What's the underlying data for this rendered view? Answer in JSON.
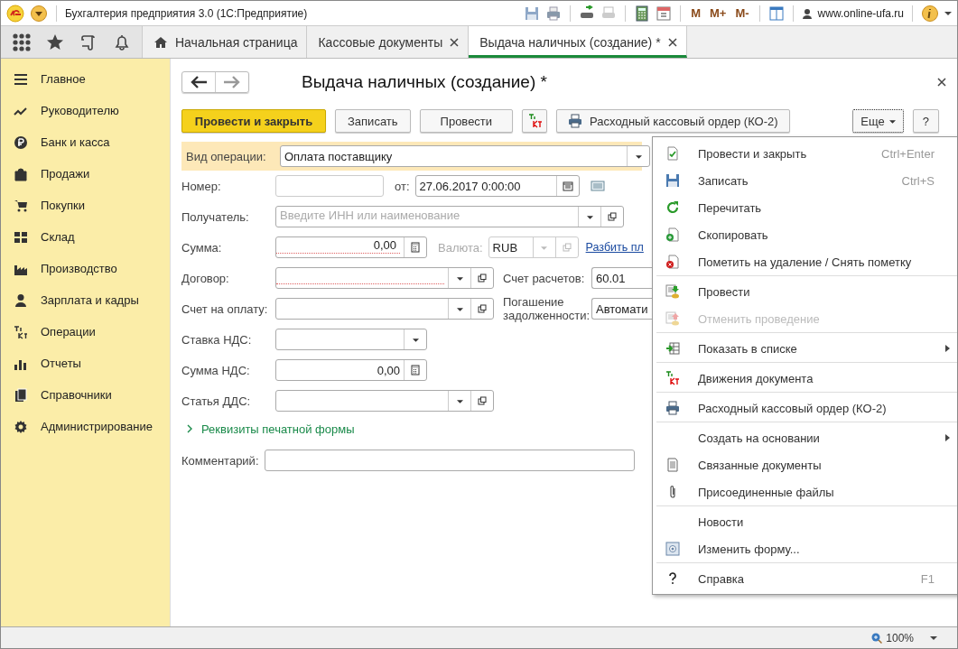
{
  "window": {
    "title": "Бухгалтерия предприятия 3.0  (1С:Предприятие)",
    "user": "www.online-ufa.ru"
  },
  "toolbar_memory": [
    "M",
    "M+",
    "M-"
  ],
  "tabs": [
    {
      "label": "Начальная страница",
      "kind": "home",
      "selected": false
    },
    {
      "label": "Кассовые документы",
      "kind": "doc",
      "selected": false
    },
    {
      "label": "Выдача наличных (создание) *",
      "kind": "doc",
      "selected": true
    }
  ],
  "sidebar": {
    "items": [
      {
        "label": "Главное",
        "kind": "lines"
      },
      {
        "label": "Руководителю",
        "kind": "trend"
      },
      {
        "label": "Банк и касса",
        "kind": "coin"
      },
      {
        "label": "Продажи",
        "kind": "bag"
      },
      {
        "label": "Покупки",
        "kind": "cart"
      },
      {
        "label": "Склад",
        "kind": "grid"
      },
      {
        "label": "Производство",
        "kind": "factory"
      },
      {
        "label": "Зарплата и кадры",
        "kind": "person"
      },
      {
        "label": "Операции",
        "kind": "dtkt"
      },
      {
        "label": "Отчеты",
        "kind": "bars"
      },
      {
        "label": "Справочники",
        "kind": "books"
      },
      {
        "label": "Администрирование",
        "kind": "gear"
      }
    ]
  },
  "form": {
    "title": "Выдача наличных (создание) *",
    "buttons": [
      {
        "label": "Провести и закрыть",
        "kind": "primary"
      },
      {
        "label": "Записать",
        "kind": "normal"
      },
      {
        "label": "Провести",
        "kind": "normal"
      },
      {
        "kind": "dtkt"
      },
      {
        "label": "Расходный кассовый ордер (КО-2)",
        "kind": "print"
      }
    ],
    "more_button": "Еще",
    "help_button": "?",
    "operation_type": {
      "label": "Вид операции:",
      "value": "Оплата поставщику"
    },
    "number": {
      "label": "Номер:"
    },
    "date": {
      "label": "от:",
      "value": "27.06.2017  0:00:00"
    },
    "recipient": {
      "label": "Получатель:",
      "placeholder": "Введите ИНН или наименование"
    },
    "amount": {
      "label": "Сумма:",
      "value": "0,00"
    },
    "currency": {
      "label": "Валюта:",
      "value": "RUB",
      "disabled": true
    },
    "split_link": "Разбить пл",
    "contract": {
      "label": "Договор:"
    },
    "settlement_account": {
      "label": "Счет расчетов:",
      "value": "60.01"
    },
    "invoice": {
      "label": "Счет на оплату:"
    },
    "debt_repayment": {
      "label": "Погашение задолженности:",
      "value": "Автомати"
    },
    "vat_rate": {
      "label": "Ставка НДС:"
    },
    "vat_amount": {
      "label": "Сумма НДС:",
      "value": "0,00"
    },
    "cash_flow_item": {
      "label": "Статья ДДС:"
    },
    "print_details": {
      "label": "Реквизиты печатной формы",
      "expanded": false
    },
    "comment": {
      "label": "Комментарий:"
    }
  },
  "menu": {
    "groups": [
      [
        {
          "label": "Провести и закрыть",
          "kind": "check",
          "shortcut": "Ctrl+Enter",
          "disabled": false,
          "submenu": false
        },
        {
          "label": "Записать",
          "kind": "save",
          "shortcut": "Ctrl+S",
          "disabled": false,
          "submenu": false
        },
        {
          "label": "Перечитать",
          "kind": "refresh",
          "disabled": false,
          "submenu": false
        },
        {
          "label": "Скопировать",
          "kind": "copy",
          "disabled": false,
          "submenu": false
        },
        {
          "label": "Пометить на удаление / Снять пометку",
          "kind": "delete",
          "disabled": false,
          "submenu": false
        }
      ],
      [
        {
          "label": "Провести",
          "kind": "post",
          "disabled": false,
          "submenu": false
        },
        {
          "label": "Отменить проведение",
          "kind": "unpost",
          "disabled": true,
          "submenu": false
        }
      ],
      [
        {
          "label": "Показать в списке",
          "kind": "list",
          "disabled": false,
          "submenu": true
        }
      ],
      [
        {
          "label": "Движения документа",
          "kind": "dtkt",
          "disabled": false,
          "submenu": false
        }
      ],
      [
        {
          "label": "Расходный кассовый ордер (КО-2)",
          "kind": "print",
          "disabled": false,
          "submenu": false
        }
      ],
      [
        {
          "label": "Создать на основании",
          "kind": "plain",
          "disabled": false,
          "submenu": true
        },
        {
          "label": "Связанные документы",
          "kind": "doc",
          "disabled": false,
          "submenu": false
        },
        {
          "label": "Присоединенные файлы",
          "kind": "clip",
          "disabled": false,
          "submenu": false
        }
      ],
      [
        {
          "label": "Новости",
          "kind": "plain",
          "disabled": false,
          "submenu": false
        },
        {
          "label": "Изменить форму...",
          "kind": "form",
          "disabled": false,
          "submenu": false
        }
      ],
      [
        {
          "label": "Справка",
          "kind": "help",
          "shortcut": "F1",
          "disabled": false,
          "submenu": false
        }
      ]
    ]
  },
  "status_bar": {
    "zoom": "100%"
  }
}
